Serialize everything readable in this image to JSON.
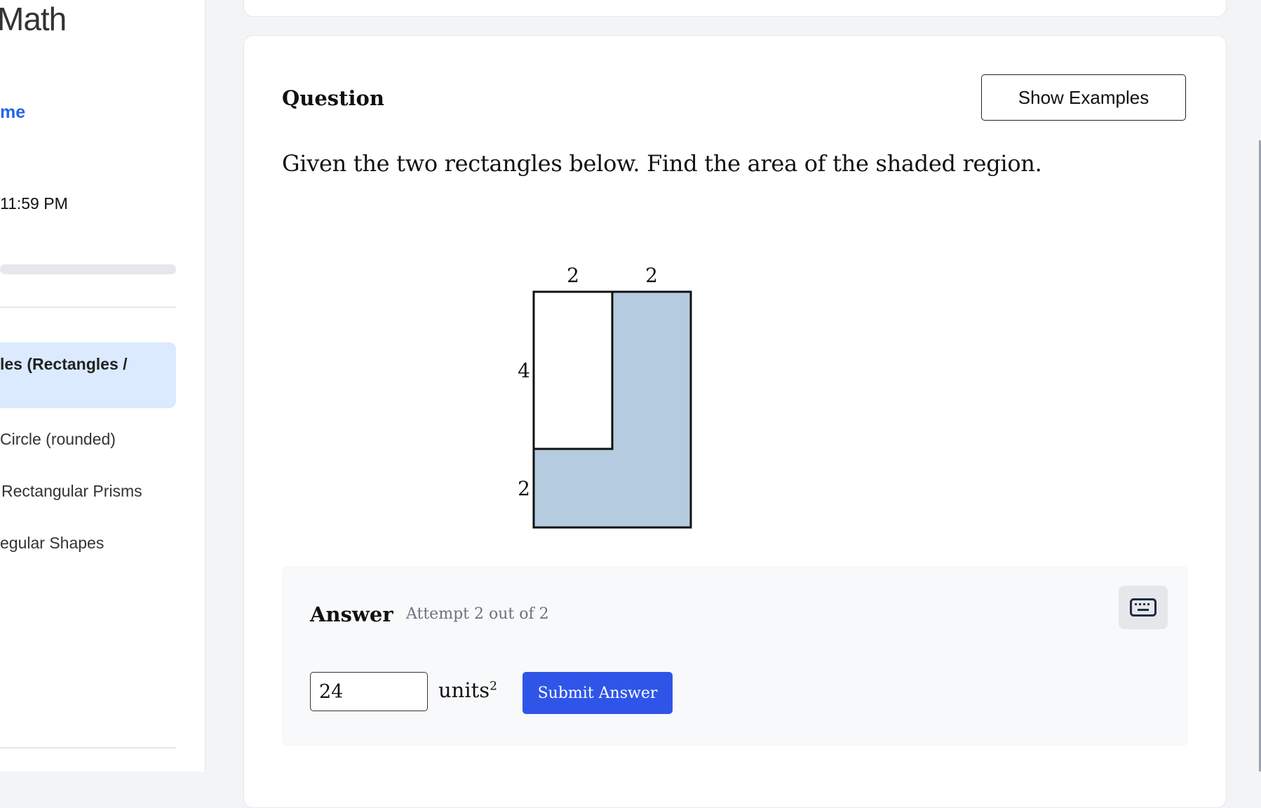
{
  "sidebar": {
    "brand": "Math",
    "home_link": "me",
    "due_time": "11:59 PM",
    "nav_active": "les (Rectangles /",
    "nav_items": [
      "Circle (rounded)",
      "Rectangular Prisms",
      "egular Shapes"
    ]
  },
  "question": {
    "title": "Question",
    "show_examples": "Show Examples",
    "prompt": "Given the two rectangles below. Find the area of the shaded region.",
    "figure": {
      "top_labels": [
        "2",
        "2"
      ],
      "left_labels": [
        "4",
        "2"
      ],
      "shade_color": "#b5cce0"
    }
  },
  "answer": {
    "title": "Answer",
    "attempt": "Attempt 2 out of 2",
    "input_value": "24",
    "units": "units",
    "units_exponent": "2",
    "submit": "Submit Answer"
  },
  "colors": {
    "accent": "#2f55e8",
    "active_nav_bg": "#dbeafe",
    "link": "#2563eb"
  }
}
